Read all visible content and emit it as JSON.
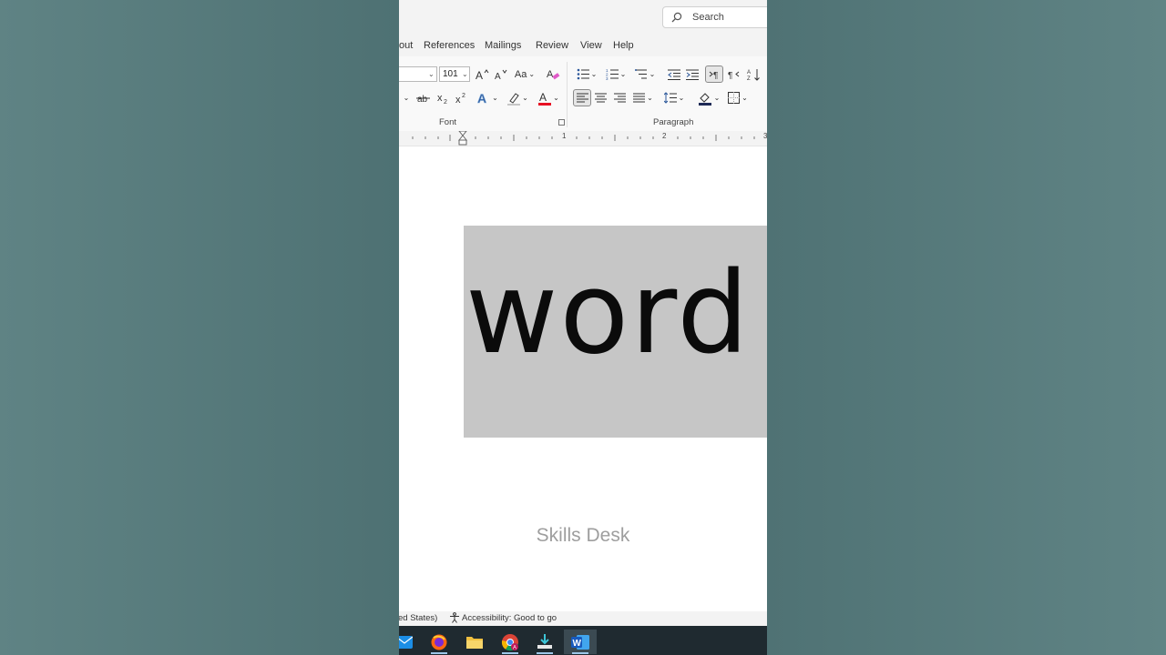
{
  "search": {
    "placeholder": "Search"
  },
  "tabs": [
    "out",
    "References",
    "Mailings",
    "Review",
    "View",
    "Help"
  ],
  "font": {
    "name": "",
    "size": "101",
    "change_case": "Aa"
  },
  "groups": {
    "font": "Font",
    "paragraph": "Paragraph"
  },
  "ruler": {
    "marks": [
      "1",
      "2",
      "3"
    ]
  },
  "document": {
    "text": "word",
    "highlight_color": "#c6c6c6",
    "watermark": "Skills Desk"
  },
  "status": {
    "language": "ed States)",
    "accessibility": "Accessibility: Good to go"
  },
  "colors": {
    "font_color": "#e81123",
    "highlight": "#c6c6c6",
    "accent": "#2b579a"
  },
  "taskbar": {
    "apps": [
      {
        "name": "mail-icon"
      },
      {
        "name": "firefox-icon"
      },
      {
        "name": "file-explorer-icon"
      },
      {
        "name": "chrome-icon"
      },
      {
        "name": "installer-icon"
      },
      {
        "name": "word-icon"
      }
    ]
  }
}
